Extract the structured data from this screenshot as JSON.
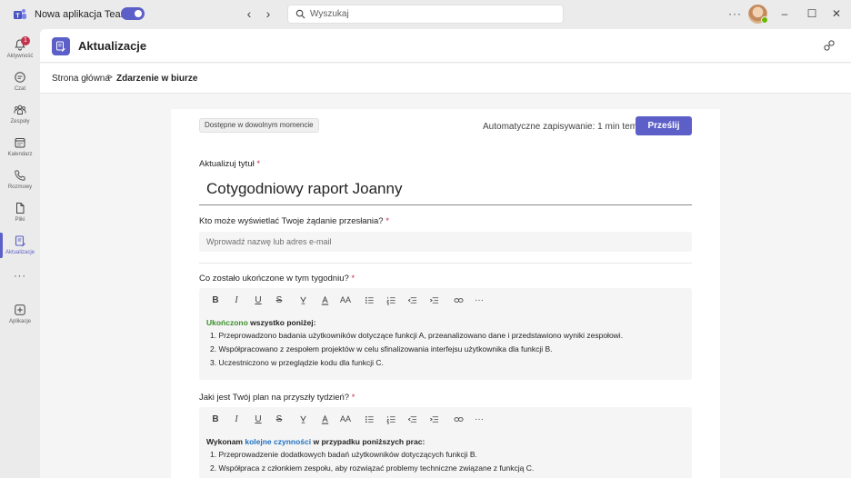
{
  "titlebar": {
    "app_name": "Nowa aplikacja Teams",
    "search_placeholder": "Wyszukaj",
    "more": "···"
  },
  "rail": {
    "items": [
      {
        "label": "Aktywność",
        "icon": "bell-icon",
        "badge": "1"
      },
      {
        "label": "Czat",
        "icon": "chat-icon"
      },
      {
        "label": "Zespoły",
        "icon": "teams-icon"
      },
      {
        "label": "Kalendarz",
        "icon": "calendar-icon"
      },
      {
        "label": "Rozmowy",
        "icon": "phone-icon"
      },
      {
        "label": "Pliki",
        "icon": "file-icon"
      },
      {
        "label": "Aktualizacje",
        "icon": "updates-icon",
        "active": true
      },
      {
        "label": "Aplikacje",
        "icon": "add-apps-icon"
      }
    ],
    "more": "···"
  },
  "header": {
    "title": "Aktualizacje"
  },
  "breadcrumb": {
    "home": "Strona główna",
    "separator": ">",
    "current": "Zdarzenie w biurze"
  },
  "form": {
    "availability": "Dostępne w dowolnym momencie",
    "autosave": "Automatyczne zapisywanie: 1 min temu",
    "submit": "Prześlij",
    "title_label": "Aktualizuj tytuł",
    "title_value": "Cotygodniowy raport Joanny",
    "viewers_label": "Kto może wyświetlać Twoje żądanie przesłania?",
    "viewers_placeholder": "Wprowadź nazwę lub adres e-mail",
    "done_label": "Co zostało ukończone w tym tygodniu?",
    "done_heading_highlight": "Ukończono",
    "done_heading_rest": " wszystko poniżej:",
    "done_items": [
      "1. Przeprowadzono badania użytkowników dotyczące funkcji A, przeanalizowano dane i przedstawiono wyniki zespołowi.",
      "2. Współpracowano z zespołem projektów w celu sfinalizowania interfejsu użytkownika dla funkcji B.",
      "3. Uczestniczono w przeglądzie kodu dla funkcji C."
    ],
    "plan_label": "Jaki jest Twój plan na przyszły tydzień?",
    "plan_heading_pre": "Wykonam ",
    "plan_heading_highlight": "kolejne czynności",
    "plan_heading_rest": " w przypadku poniższych prac:",
    "plan_items": [
      "1. Przeprowadzenie dodatkowych badań użytkowników dotyczących funkcji B.",
      "2. Współpraca z członkiem zespołu, aby rozwiązać problemy techniczne związane z funkcją C."
    ],
    "required_mark": "*",
    "toolbar": {
      "bold": "B",
      "italic": "I",
      "underline": "U",
      "strike": "S",
      "font_size": "AA",
      "more": "···"
    }
  },
  "colors": {
    "accent": "#5b5fc7",
    "green_highlight": "#3a8f2a",
    "blue_highlight": "#1f6fc0",
    "required": "#c4314b"
  }
}
